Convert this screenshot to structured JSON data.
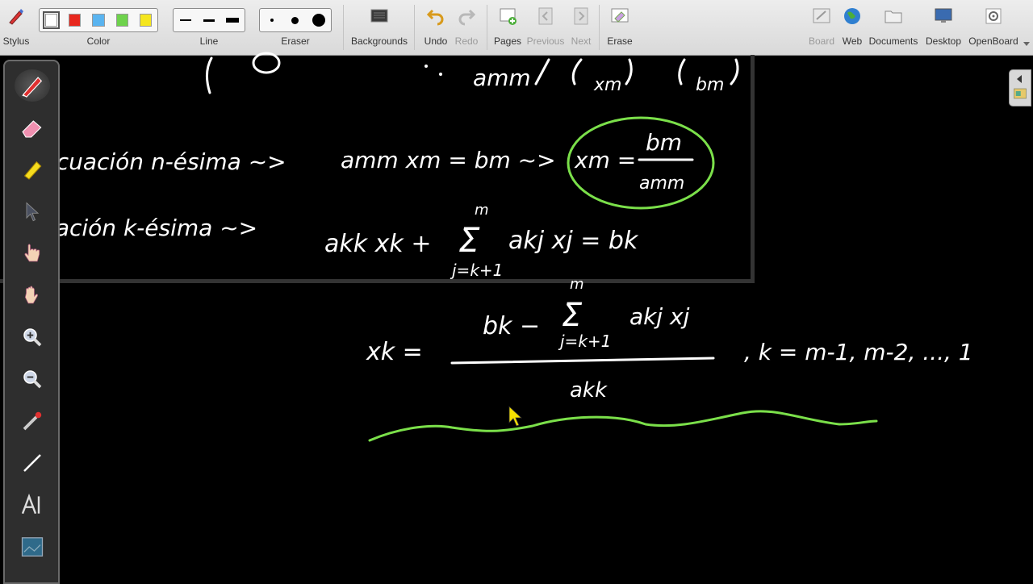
{
  "toolbar": {
    "stylus": "Stylus",
    "color": "Color",
    "line": "Line",
    "eraser": "Eraser",
    "backgrounds": "Backgrounds",
    "undo": "Undo",
    "redo": "Redo",
    "pages": "Pages",
    "previous": "Previous",
    "next": "Next",
    "erase": "Erase",
    "board": "Board",
    "web": "Web",
    "documents": "Documents",
    "desktop": "Desktop",
    "openboard": "OpenBoard"
  },
  "colors": [
    "#ffffff",
    "#e8281e",
    "#5ab4f0",
    "#6ed24c",
    "#f5e61e"
  ],
  "board_text": {
    "row1_amm": "amm",
    "row1_xm": "xm",
    "row1_bm": "bm",
    "eq_n_label": "Ecuación n-ésima ~>",
    "eq_n_eq": "amm xm = bm ~>",
    "eq_n_boxed_lhs": "xm =",
    "eq_n_boxed_num": "bm",
    "eq_n_boxed_den": "amm",
    "eq_k_label": "Ecuación k-ésima ~>",
    "eq_k_eq": "akk xk +",
    "eq_k_sum_top": "m",
    "eq_k_sum": "Σ",
    "eq_k_sum_bottom": "j=k+1",
    "eq_k_term": "akj xj = bk",
    "xk_lhs": "xk =",
    "xk_num_b": "bk −",
    "xk_num_sum_top": "m",
    "xk_num_sum": "Σ",
    "xk_num_sum_bottom": "j=k+1",
    "xk_num_term": "akj xj",
    "xk_den": "akk",
    "xk_range": ", k = m-1, m-2, ..., 1"
  }
}
